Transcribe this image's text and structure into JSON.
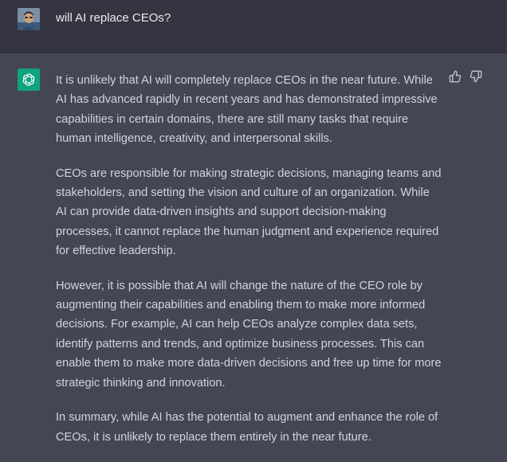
{
  "conversation": {
    "user_message": "will AI replace CEOs?",
    "assistant_paragraphs": [
      "It is unlikely that AI will completely replace CEOs in the near future. While AI has advanced rapidly in recent years and has demonstrated impressive capabilities in certain domains, there are still many tasks that require human intelligence, creativity, and interpersonal skills.",
      "CEOs are responsible for making strategic decisions, managing teams and stakeholders, and setting the vision and culture of an organization. While AI can provide data-driven insights and support decision-making processes, it cannot replace the human judgment and experience required for effective leadership.",
      "However, it is possible that AI will change the nature of the CEO role by augmenting their capabilities and enabling them to make more informed decisions. For example, AI can help CEOs analyze complex data sets, identify patterns and trends, and optimize business processes. This can enable them to make more data-driven decisions and free up time for more strategic thinking and innovation.",
      "In summary, while AI has the potential to augment and enhance the role of CEOs, it is unlikely to replace them entirely in the near future."
    ]
  },
  "icons": {
    "user_avatar": "user-avatar",
    "assistant_avatar": "openai-logo-icon",
    "thumbs_up": "thumbs-up-icon",
    "thumbs_down": "thumbs-down-icon"
  },
  "colors": {
    "user_row_bg": "#343541",
    "assistant_row_bg": "#444654",
    "assistant_avatar_bg": "#10a37f",
    "text": "#d1d5db"
  }
}
